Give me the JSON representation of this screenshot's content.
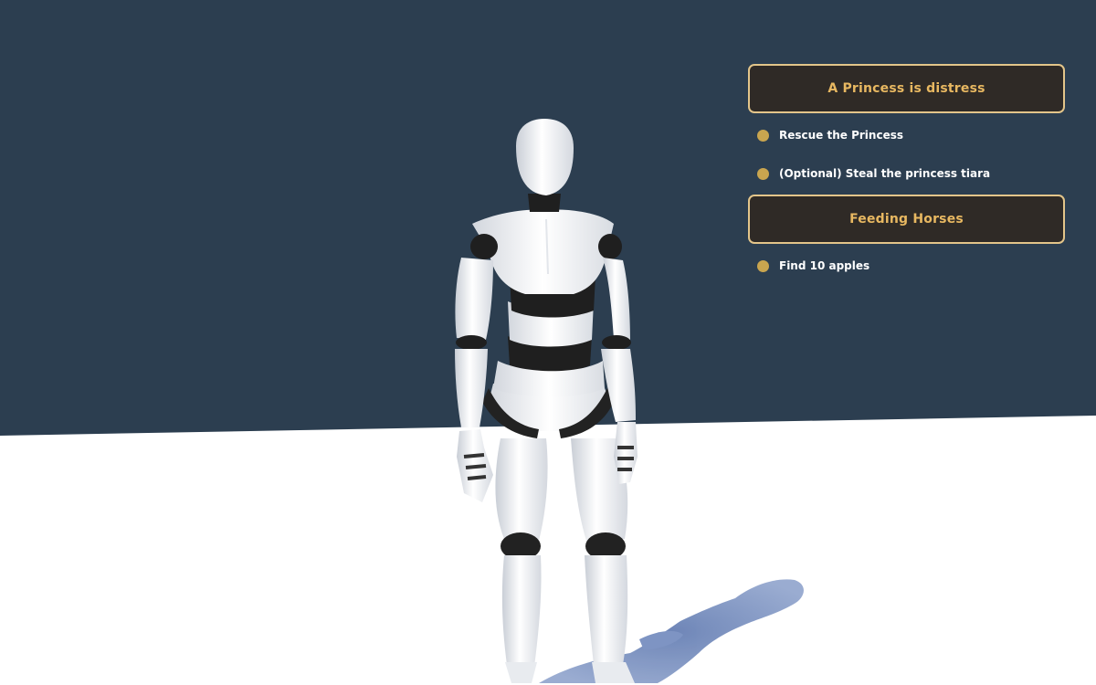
{
  "scene": {
    "sky_color": "#2c3e50",
    "ground_color": "#ffffff",
    "character": "white humanoid mannequin robot, idle stance",
    "shadow_color": "#6b84b8"
  },
  "quest_log": {
    "quests": [
      {
        "title": "A Princess is distress",
        "objectives": [
          "Rescue the Princess",
          "(Optional) Steal the princess tiara"
        ]
      },
      {
        "title": "Feeding Horses",
        "objectives": [
          "Find 10 apples"
        ]
      }
    ],
    "colors": {
      "header_background": "#2f2a26",
      "header_border": "#e3c58a",
      "header_text": "#e8b861",
      "bullet": "#c9a54f",
      "objective_text": "#ffffff"
    }
  }
}
